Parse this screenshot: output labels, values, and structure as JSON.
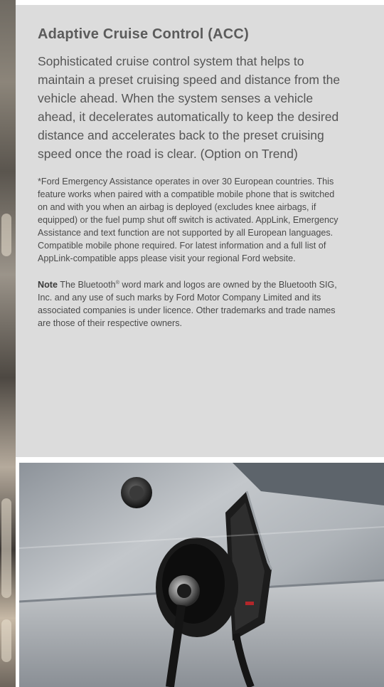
{
  "section": {
    "title": "Adaptive Cruise Control (ACC)",
    "lead": "Sophisticated cruise control system that helps to maintain a preset cruising speed and distance from the vehicle ahead. When the system senses a vehicle ahead, it decelerates automatically to keep the desired distance and accelerates back to the preset cruising speed once the road is clear. (Option on Trend)",
    "footnote": "*Ford Emergency Assistance operates in over 30 European countries. This feature works when paired with a compatible mobile phone that is switched on and with you when an airbag is deployed (excludes knee airbags, if equipped) or the fuel pump shut off switch is activated. AppLink, Emergency Assistance and text function are not supported by all European languages. Compatible mobile phone required. For latest information and a full list of AppLink-compatible apps please visit your regional Ford website.",
    "note_label": "Note",
    "note_text_before": " The Bluetooth",
    "note_reg": "®",
    "note_text_after": " word mark and logos are owned by the Bluetooth SIG, Inc. and any use of such marks by Ford Motor Company Limited and its associated companies is under licence. Other trademarks and trade names are those of their respective owners."
  },
  "colors": {
    "panel_bg": "#dcdcdc",
    "title": "#5b5b5b",
    "body_text": "#555555"
  },
  "images": {
    "left_strip": "partial photo of a person (cropped at left edge)",
    "bottom_photo": "close-up of vehicle side with open fuel/charging flap and cable"
  }
}
